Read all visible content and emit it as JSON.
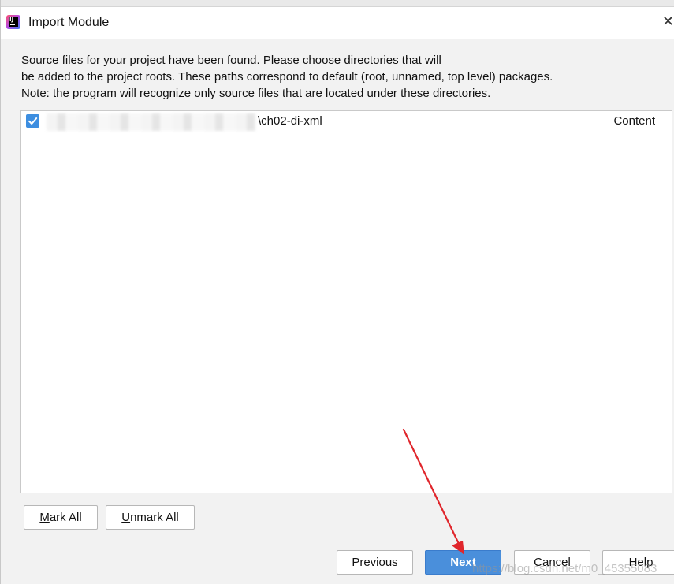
{
  "window": {
    "title": "Import Module",
    "app_icon": "intellij-idea-icon",
    "close_glyph": "✕"
  },
  "description": {
    "lines": [
      "Source files for your project have been found. Please choose directories that will",
      "be added to the project roots. These paths correspond to default (root, unnamed, top level) packages.",
      "Note: the program will recognize only source files that are located under these directories."
    ]
  },
  "directories": [
    {
      "checked": true,
      "path_visible": "\\ch02-di-xml",
      "type": "Content"
    }
  ],
  "buttons": {
    "mark_all": {
      "mnemonic": "M",
      "rest": "ark All"
    },
    "unmark_all": {
      "mnemonic": "U",
      "rest": "nmark All"
    },
    "previous": {
      "mnemonic": "P",
      "rest": "revious"
    },
    "next": {
      "mnemonic": "N",
      "rest": "ext"
    },
    "cancel": "Cancel",
    "help": "Help"
  },
  "annotation": {
    "color": "#e0262c"
  },
  "watermark": "https://blog.csdn.net/m0_45355083",
  "colors": {
    "primary_button": "#4a8fdb",
    "checkbox": "#3d8ee0",
    "dialog_bg": "#f2f2f2"
  }
}
